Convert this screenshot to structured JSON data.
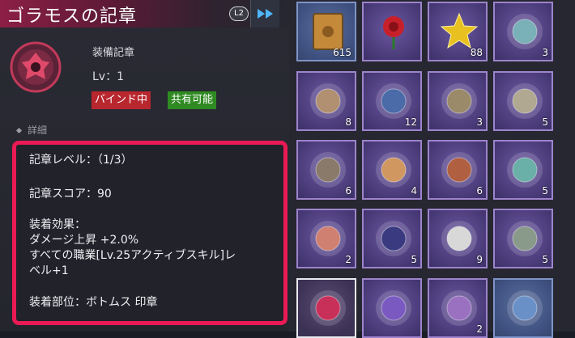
{
  "header": {
    "title": "ゴラモスの記章",
    "l2_label": "L2"
  },
  "item": {
    "kind": "装備記章",
    "level": "Lv：1",
    "tags": {
      "bind": "バインド中",
      "share": "共有可能"
    }
  },
  "detail": {
    "section_label": "詳細",
    "lines": [
      "記章レベル：（1/3）",
      "記章スコア：90",
      "装着効果：",
      "ダメージ上昇 +2.0%",
      "すべての職業[Lv.25アクティブスキル]レ",
      "ベル+1",
      "装着部位：ボトムス 印章"
    ]
  },
  "inventory": {
    "slots": [
      {
        "icon": "book-icon",
        "count": "615",
        "style": "blue"
      },
      {
        "icon": "rose-icon",
        "count": "",
        "style": "purple"
      },
      {
        "icon": "star-icon",
        "count": "88",
        "style": "purple"
      },
      {
        "icon": "emblem-icon",
        "count": "3",
        "style": "purple"
      },
      {
        "icon": "tree-emblem-icon",
        "count": "8",
        "style": "purple"
      },
      {
        "icon": "blade-emblem-icon",
        "count": "12",
        "style": "purple"
      },
      {
        "icon": "armor-emblem-icon",
        "count": "3",
        "style": "purple"
      },
      {
        "icon": "helmet-emblem-icon",
        "count": "5",
        "style": "purple"
      },
      {
        "icon": "gun-emblem-icon",
        "count": "6",
        "style": "purple"
      },
      {
        "icon": "girl-emblem-icon",
        "count": "4",
        "style": "purple"
      },
      {
        "icon": "cowboy-emblem-icon",
        "count": "6",
        "style": "purple"
      },
      {
        "icon": "crystal-emblem-icon",
        "count": "5",
        "style": "purple"
      },
      {
        "icon": "warrior-emblem-icon",
        "count": "2",
        "style": "purple"
      },
      {
        "icon": "witch-emblem-icon",
        "count": "5",
        "style": "purple"
      },
      {
        "icon": "masked-emblem-icon",
        "count": "9",
        "style": "purple"
      },
      {
        "icon": "robot-emblem-icon",
        "count": "5",
        "style": "purple"
      },
      {
        "icon": "golamos-emblem-icon",
        "count": "",
        "style": "sel"
      },
      {
        "icon": "sword-emblem-icon",
        "count": "",
        "style": "purple"
      },
      {
        "icon": "mage-emblem-icon",
        "count": "2",
        "style": "purple"
      },
      {
        "icon": "blue-emblem-icon",
        "count": "",
        "style": "blue"
      }
    ]
  },
  "colors": {
    "title_gradient": "#8c1f45",
    "highlight_border": "#ea1a55",
    "bind_tag": "#b8262e",
    "share_tag": "#2f8a22",
    "slot_purple": "#4a3b79"
  }
}
